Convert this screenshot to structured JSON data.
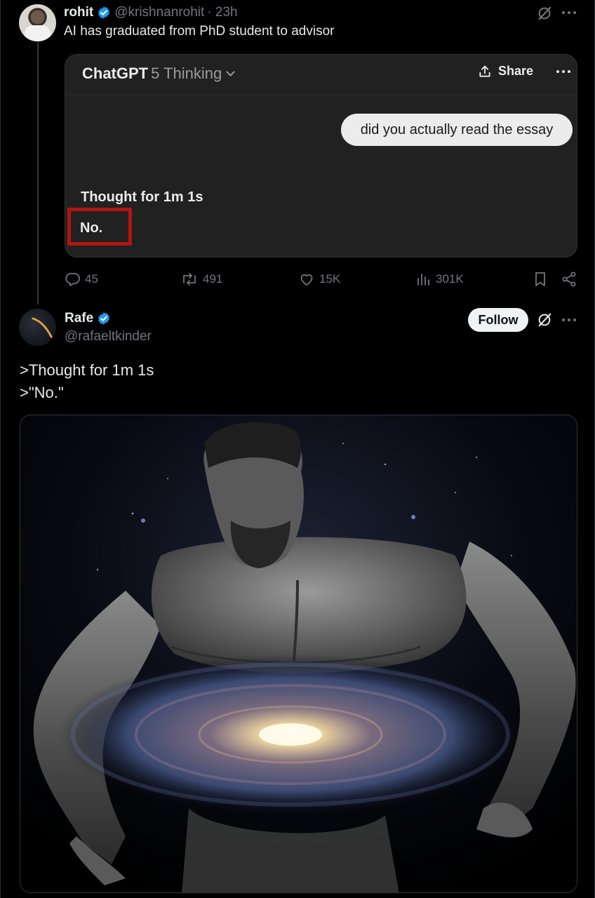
{
  "post1": {
    "name": "rohit",
    "handle": "@krishnanrohit",
    "time": "· 23h",
    "text": "AI has graduated from PhD student to advisor",
    "embed": {
      "app_title": "ChatGPT",
      "model": "5 Thinking",
      "share_label": "Share",
      "user_message": "did you actually read the essay",
      "thought": "Thought for 1m 1s",
      "reply": "No.",
      "highlight_color": "#b2150f"
    },
    "actions": {
      "replies": "45",
      "reposts": "491",
      "likes": "15K",
      "views": "301K"
    }
  },
  "post2": {
    "name": "Rafe",
    "handle": "@rafaeltkinder",
    "follow_label": "Follow",
    "lines": [
      ">Thought for 1m 1s",
      ">\"No.\""
    ]
  },
  "colors": {
    "background": "#000000",
    "verified": "#1d9bf0",
    "muted": "#71767b"
  },
  "icons": [
    "verified-badge-icon",
    "grok-icon",
    "more-icon",
    "chevron-down-icon",
    "share-upload-icon",
    "reply-icon",
    "repost-icon",
    "like-icon",
    "views-icon",
    "bookmark-icon",
    "share-icon"
  ]
}
